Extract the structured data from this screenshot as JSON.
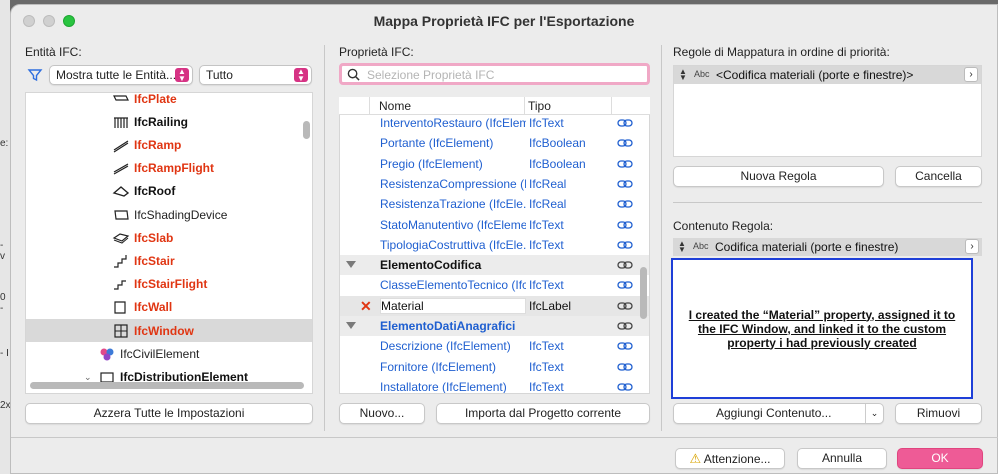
{
  "window": {
    "title": "Mappa Proprietà IFC per l'Esportazione"
  },
  "background_fragments": [
    "e:",
    "- v",
    "0 -",
    "- I",
    "2x"
  ],
  "entities": {
    "label": "Entità IFC:",
    "filter_icon": "funnel-icon",
    "show_popup": "Mostra tutte le Entità...",
    "scope_popup": "Tutto",
    "items": [
      {
        "label": "IfcPlate",
        "style": "red",
        "icon": "plate-icon"
      },
      {
        "label": "IfcRailing",
        "style": "blk",
        "icon": "railing-icon"
      },
      {
        "label": "IfcRamp",
        "style": "red",
        "icon": "ramp-icon"
      },
      {
        "label": "IfcRampFlight",
        "style": "red",
        "icon": "ramp-flight-icon"
      },
      {
        "label": "IfcRoof",
        "style": "blk",
        "icon": "roof-icon"
      },
      {
        "label": "IfcShadingDevice",
        "style": "plain",
        "icon": "shading-device-icon"
      },
      {
        "label": "IfcSlab",
        "style": "red",
        "icon": "slab-icon"
      },
      {
        "label": "IfcStair",
        "style": "red",
        "icon": "stair-icon"
      },
      {
        "label": "IfcStairFlight",
        "style": "red",
        "icon": "stair-flight-icon"
      },
      {
        "label": "IfcWall",
        "style": "red",
        "icon": "wall-icon"
      },
      {
        "label": "IfcWindow",
        "style": "red",
        "icon": "window-icon",
        "selected": true
      },
      {
        "label": "IfcCivilElement",
        "style": "plain",
        "icon": "civil-element-icon"
      },
      {
        "label": "IfcDistributionElement",
        "style": "blk",
        "icon": "distribution-element-icon"
      }
    ],
    "reset_button": "Azzera Tutte le Impostazioni"
  },
  "properties": {
    "label": "Proprietà IFC:",
    "search_placeholder": "Selezione Proprietà IFC",
    "col_name": "Nome",
    "col_type": "Tipo",
    "rows": [
      {
        "name": "InterventoRestauro (IfcElem...",
        "type": "IfcText",
        "kind": "prop"
      },
      {
        "name": "Portante (IfcElement)",
        "type": "IfcBoolean",
        "kind": "prop"
      },
      {
        "name": "Pregio (IfcElement)",
        "type": "IfcBoolean",
        "kind": "prop"
      },
      {
        "name": "ResistenzaCompressione (I...",
        "type": "IfcReal",
        "kind": "prop"
      },
      {
        "name": "ResistenzaTrazione (IfcEle...",
        "type": "IfcReal",
        "kind": "prop"
      },
      {
        "name": "StatoManutentivo (IfcEleme...",
        "type": "IfcText",
        "kind": "prop"
      },
      {
        "name": "TipologiaCostruttiva (IfcEle...",
        "type": "IfcText",
        "kind": "prop"
      },
      {
        "name": "ElementoCodifica",
        "type": "",
        "kind": "group"
      },
      {
        "name": "ClasseElementoTecnico (Ifc...",
        "type": "IfcText",
        "kind": "prop"
      },
      {
        "name": "Material",
        "type": "IfcLabel",
        "kind": "edit"
      },
      {
        "name": "ElementoDatiAnagrafici",
        "type": "",
        "kind": "group-blue"
      },
      {
        "name": "Descrizione (IfcElement)",
        "type": "IfcText",
        "kind": "prop"
      },
      {
        "name": "Fornitore (IfcElement)",
        "type": "IfcText",
        "kind": "prop"
      },
      {
        "name": "Installatore (IfcElement)",
        "type": "IfcText",
        "kind": "prop"
      }
    ],
    "new_button": "Nuovo...",
    "import_button": "Importa dal Progetto corrente"
  },
  "rules": {
    "label": "Regole di Mappatura in ordine di priorità:",
    "items": [
      {
        "abc": "Abc",
        "text": "<Codifica materiali (porte e finestre)>"
      }
    ],
    "new_rule_button": "Nuova Regola",
    "delete_button": "Cancella",
    "content_label": "Contenuto Regola:",
    "content_item": {
      "abc": "Abc",
      "text": "Codifica materiali (porte e finestre)"
    },
    "annotation": "I created the “Material” property, assigned it to the IFC Window, and linked it to the custom property i had previously created",
    "add_content_button": "Aggiungi Contenuto...",
    "remove_button": "Rimuovi"
  },
  "footer": {
    "warning_button": "Attenzione...",
    "cancel_button": "Annulla",
    "ok_button": "OK"
  },
  "colors": {
    "accent": "#ee5b96",
    "entity_red": "#e03512",
    "link_blue": "#1f5fd0",
    "annotation_border": "#1e3fd8"
  }
}
